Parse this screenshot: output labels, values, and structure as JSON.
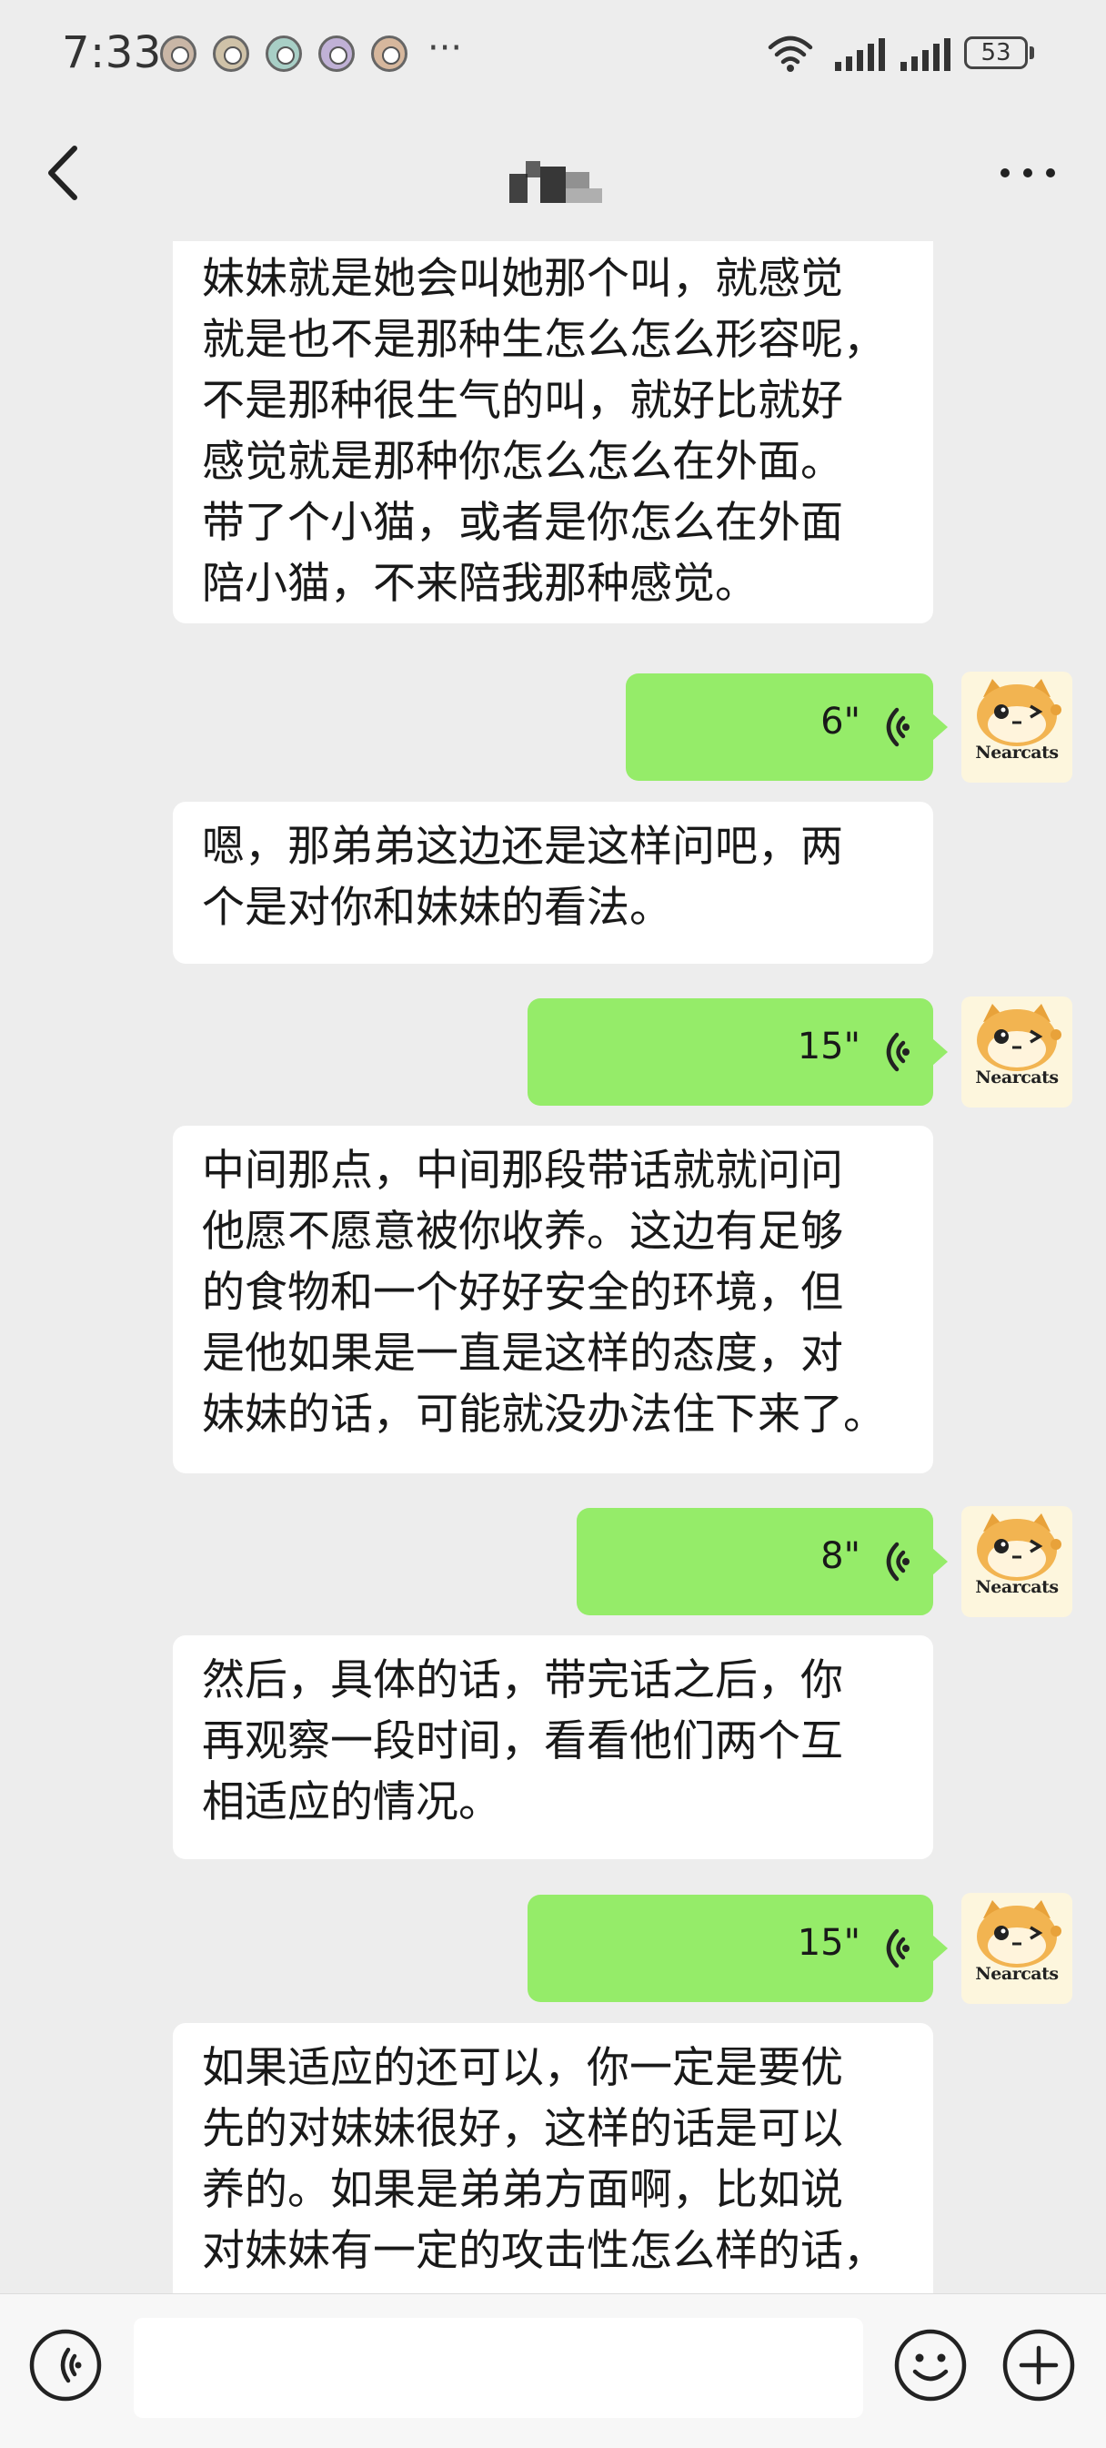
{
  "status_bar": {
    "time": "7:33",
    "more_notifications": "···",
    "battery_level": "53"
  },
  "nav": {
    "back_icon": "chevron-left-icon",
    "contact_name": "",
    "menu_icon": "more-horizontal-icon"
  },
  "colors": {
    "background": "#ededed",
    "incoming_bubble": "#ffffff",
    "outgoing_bubble": "#95ec69",
    "input_bar": "#f7f7f7"
  },
  "messages": [
    {
      "type": "text",
      "direction": "incoming",
      "lines": [
        "妹妹就是她会叫她那个叫，就感觉",
        "就是也不是那种生怎么怎么形容呢，",
        "不是那种很生气的叫，就好比就好",
        "感觉就是那种你怎么怎么在外面。",
        "带了个小猫，或者是你怎么在外面",
        "陪小猫，不来陪我那种感觉。"
      ]
    },
    {
      "type": "voice",
      "direction": "outgoing",
      "duration": "6\"",
      "avatar_text": "Nearcats"
    },
    {
      "type": "text",
      "direction": "incoming",
      "lines": [
        "嗯，那弟弟这边还是这样问吧，两",
        "个是对你和妹妹的看法。"
      ]
    },
    {
      "type": "voice",
      "direction": "outgoing",
      "duration": "15\"",
      "avatar_text": "Nearcats"
    },
    {
      "type": "text",
      "direction": "incoming",
      "lines": [
        "中间那点，中间那段带话就就问问",
        "他愿不愿意被你收养。这边有足够",
        "的食物和一个好好安全的环境，但",
        "是他如果是一直是这样的态度，对",
        "妹妹的话，可能就没办法住下来了。"
      ]
    },
    {
      "type": "voice",
      "direction": "outgoing",
      "duration": "8\"",
      "avatar_text": "Nearcats"
    },
    {
      "type": "text",
      "direction": "incoming",
      "lines": [
        "然后，具体的话，带完话之后，你",
        "再观察一段时间，看看他们两个互",
        "相适应的情况。"
      ]
    },
    {
      "type": "voice",
      "direction": "outgoing",
      "duration": "15\"",
      "avatar_text": "Nearcats"
    },
    {
      "type": "text",
      "direction": "incoming",
      "lines": [
        "如果适应的还可以，你一定是要优",
        "先的对妹妹很好，这样的话是可以",
        "养的。如果是弟弟方面啊，比如说",
        "对妹妹有一定的攻击性怎么样的话，"
      ]
    }
  ],
  "input_bar": {
    "voice_toggle_icon": "voice-input-icon",
    "placeholder": "",
    "emoji_icon": "emoji-icon",
    "plus_icon": "plus-circle-icon"
  }
}
